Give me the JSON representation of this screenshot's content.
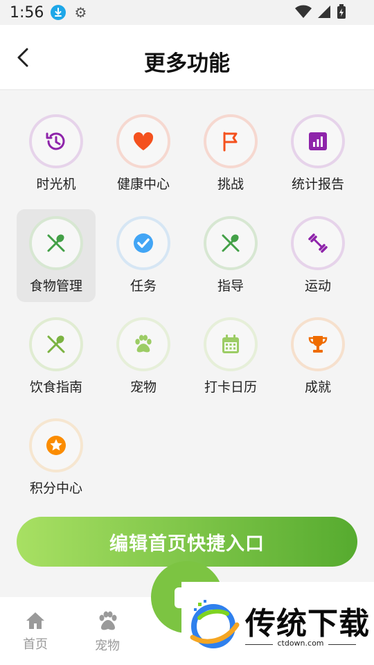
{
  "status_bar": {
    "time": "1:56"
  },
  "header": {
    "title": "更多功能"
  },
  "features": [
    {
      "label": "时光机",
      "icon": "history-icon",
      "color": "#8e24aa",
      "ring": "#e6d3ea"
    },
    {
      "label": "健康中心",
      "icon": "heart-icon",
      "color": "#f4511e",
      "ring": "#f6d8d0"
    },
    {
      "label": "挑战",
      "icon": "flag-icon",
      "color": "#f4511e",
      "ring": "#f6d8d0"
    },
    {
      "label": "统计报告",
      "icon": "chart-icon",
      "color": "#8e24aa",
      "ring": "#e6d3ea"
    },
    {
      "label": "食物管理",
      "icon": "utensils-icon",
      "color": "#43a047",
      "ring": "#d7e7d2"
    },
    {
      "label": "任务",
      "icon": "check-circle-icon",
      "color": "#42a5f5",
      "ring": "#d6e6f4"
    },
    {
      "label": "指导",
      "icon": "utensils-icon",
      "color": "#43a047",
      "ring": "#d7e7d2"
    },
    {
      "label": "运动",
      "icon": "dumbbell-icon",
      "color": "#8e24aa",
      "ring": "#e6d3ea"
    },
    {
      "label": "饮食指南",
      "icon": "utensils-icon",
      "color": "#7cb342",
      "ring": "#e0ecd2"
    },
    {
      "label": "宠物",
      "icon": "paw-icon",
      "color": "#9ccc65",
      "ring": "#e6efd9"
    },
    {
      "label": "打卡日历",
      "icon": "calendar-icon",
      "color": "#9ccc65",
      "ring": "#e6efd9"
    },
    {
      "label": "成就",
      "icon": "trophy-icon",
      "color": "#ef6c00",
      "ring": "#f6e0cd"
    },
    {
      "label": "积分中心",
      "icon": "star-icon",
      "color": "#fb8c00",
      "ring": "#f6e6d0"
    }
  ],
  "edit_button": {
    "label": "编辑首页快捷入口"
  },
  "tabbar": {
    "tabs": [
      {
        "label": "首页",
        "icon": "home-icon"
      },
      {
        "label": "宠物",
        "icon": "paw-icon"
      }
    ]
  },
  "watermark": {
    "title": "传统下载",
    "url": "ctdown.com"
  }
}
